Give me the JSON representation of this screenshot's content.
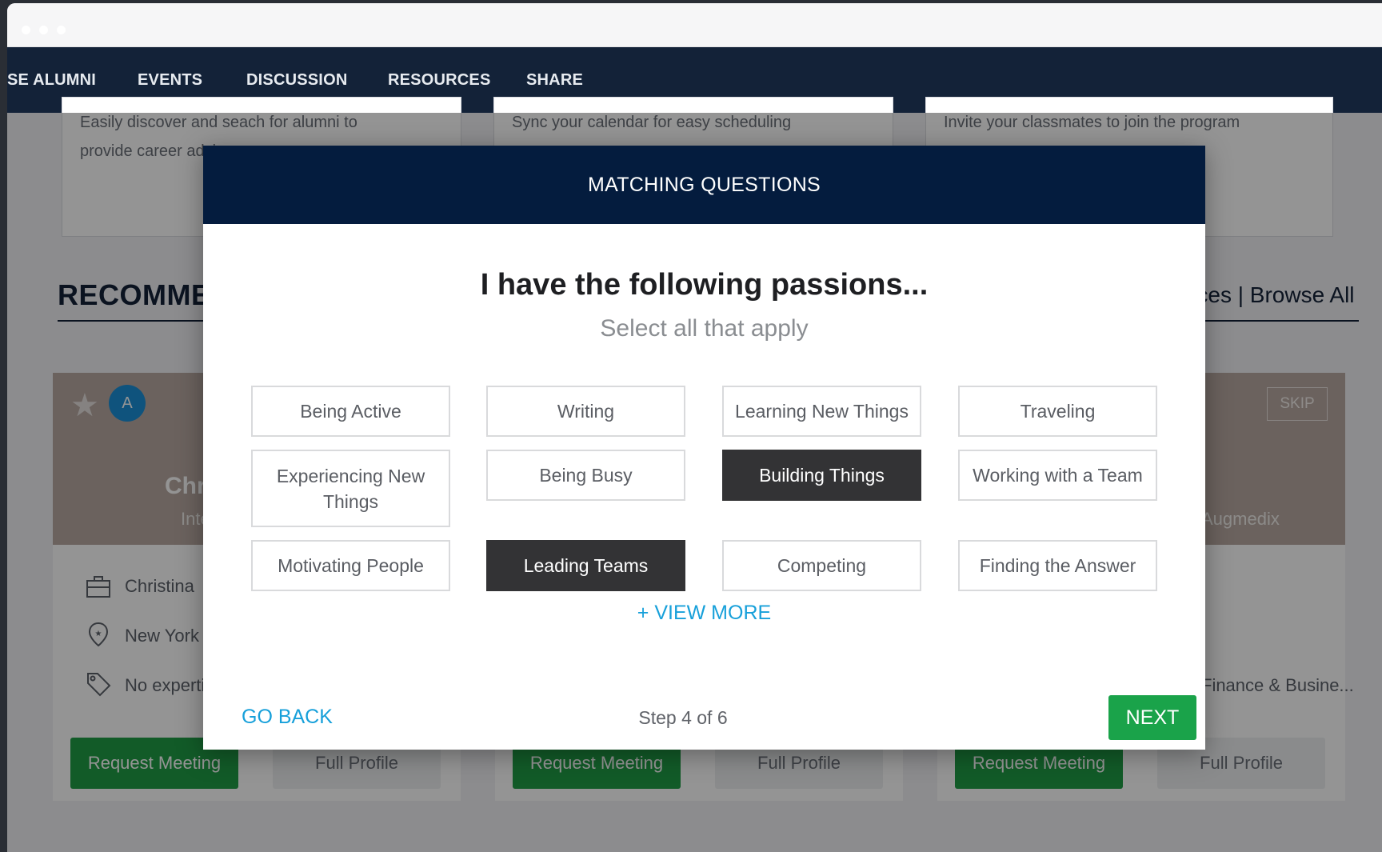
{
  "nav": {
    "items": [
      "SE ALUMNI",
      "EVENTS",
      "DISCUSSION",
      "RESOURCES",
      "SHARE"
    ]
  },
  "features": [
    "Easily discover and seach for alumni to provide career advice",
    "Sync your calendar for easy scheduling",
    "Invite your classmates to join the program"
  ],
  "recommend": {
    "title": "RECOMMENDED",
    "links": "Preferences | Browse All"
  },
  "cards": [
    {
      "avatar_letter": "A",
      "name": "Christina",
      "subtitle": "Intern",
      "company": "Christina",
      "location": "New York",
      "expertise": "No expertise",
      "request_label": "Request Meeting",
      "profile_label": "Full Profile"
    },
    {
      "request_label": "Request Meeting",
      "profile_label": "Full Profile"
    },
    {
      "subtitle": "Augmedix",
      "skip_label": "SKIP",
      "expertise": "Finance & Busine...",
      "request_label": "Request Meeting",
      "profile_label": "Full Profile"
    }
  ],
  "modal": {
    "header": "MATCHING QUESTIONS",
    "heading": "I have the following passions...",
    "subheading": "Select all that apply",
    "options": [
      {
        "label": "Being Active",
        "selected": false
      },
      {
        "label": "Writing",
        "selected": false
      },
      {
        "label": "Learning New Things",
        "selected": false
      },
      {
        "label": "Traveling",
        "selected": false
      },
      {
        "label": "Experiencing New Things",
        "selected": false
      },
      {
        "label": "Being Busy",
        "selected": false
      },
      {
        "label": "Building Things",
        "selected": true
      },
      {
        "label": "Working with a Team",
        "selected": false
      },
      {
        "label": "Motivating People",
        "selected": false
      },
      {
        "label": "Leading Teams",
        "selected": true
      },
      {
        "label": "Competing",
        "selected": false
      },
      {
        "label": "Finding the Answer",
        "selected": false
      }
    ],
    "view_more": "+ VIEW MORE",
    "go_back": "GO BACK",
    "step": "Step 4 of 6",
    "next": "NEXT"
  },
  "colors": {
    "nav_bg": "#132238",
    "modal_header_bg": "#041c3e",
    "selected_bg": "#333335",
    "accent_link": "#17a0da",
    "primary_button": "#1aa34a"
  }
}
